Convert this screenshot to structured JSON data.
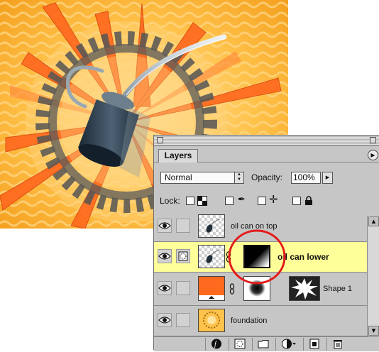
{
  "panel": {
    "tab_label": "Layers",
    "blend_mode": "Normal",
    "opacity_label": "Opacity:",
    "opacity_value": "100%",
    "lock_label": "Lock:"
  },
  "layers": [
    {
      "name": "oil can on top",
      "visible": true,
      "selected": false
    },
    {
      "name": "oil can lower",
      "visible": true,
      "selected": true
    },
    {
      "name": "Shape 1",
      "visible": true,
      "selected": false
    },
    {
      "name": "foundation",
      "visible": true,
      "selected": false
    }
  ],
  "icons": {
    "eye": "eye-icon",
    "link": "link-icon",
    "brush": "brush-icon",
    "move": "move-icon",
    "lock": "lock-icon",
    "trash": "trash-icon"
  },
  "colors": {
    "background_orange": "#f5a623",
    "starburst": "#ff6a1f",
    "selected_row": "#ffff99",
    "highlight_circle": "#e31b1b"
  }
}
